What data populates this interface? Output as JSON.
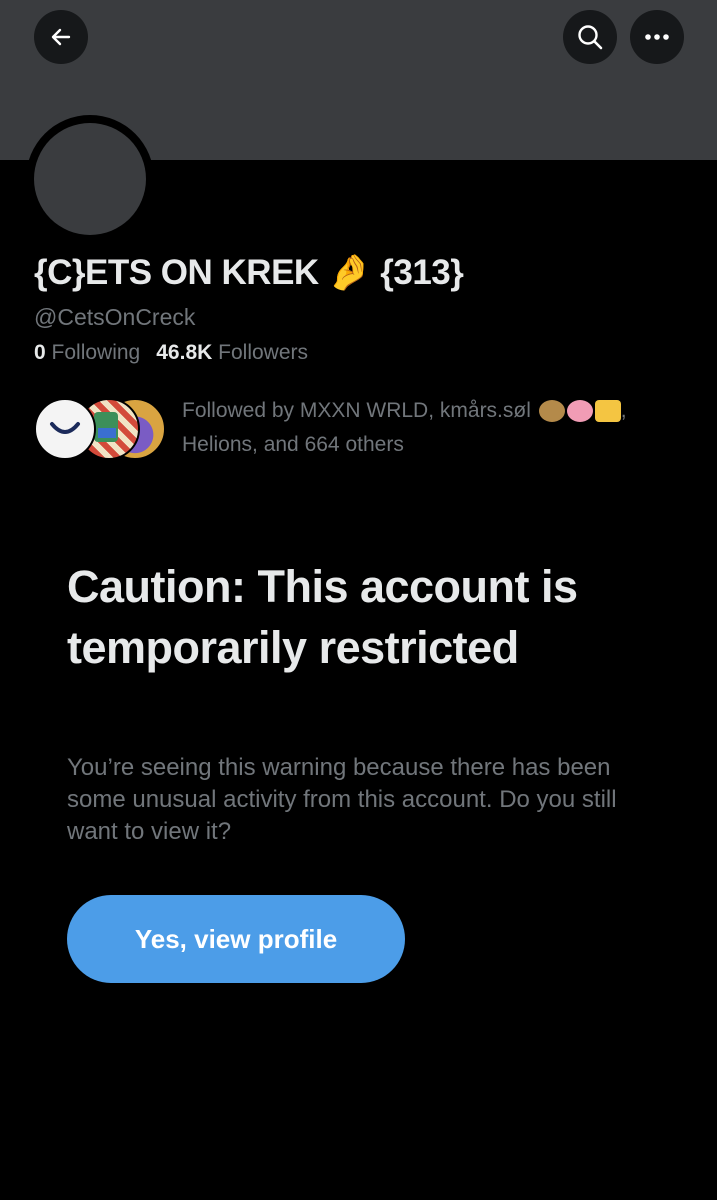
{
  "header": {
    "back_icon": "arrow-left-icon",
    "search_icon": "search-icon",
    "more_icon": "more-horizontal-icon"
  },
  "profile": {
    "display_name": "{C}ETS ON KREK 🤌 {313}",
    "handle": "@CetsOnCreck",
    "following_count": "0",
    "following_label": "Following",
    "followers_count": "46.8K",
    "followers_label": "Followers",
    "followed_by_line1": "Followed by MXXN WRLD, kmårs.søl",
    "followed_by_line1_tail": ",",
    "followed_by_line2": "Helions, and 664 others"
  },
  "warning": {
    "title": "Caution: This account is temporarily restricted",
    "body": "You’re seeing this warning because there has been some unusual activity from this account. Do you still want to view it?",
    "button_label": "Yes, view profile"
  },
  "colors": {
    "background": "#000000",
    "banner": "#3a3c3f",
    "accent": "#4c9de8",
    "muted_text": "#71767b",
    "primary_text": "#e7e9ea"
  }
}
